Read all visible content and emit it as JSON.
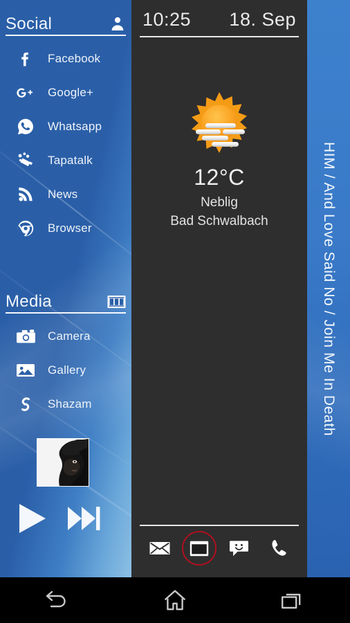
{
  "sidebar": {
    "sections": [
      {
        "title": "Social",
        "icon": "person-icon",
        "items": [
          {
            "label": "Facebook",
            "icon": "facebook-icon"
          },
          {
            "label": "Google+",
            "icon": "googleplus-icon"
          },
          {
            "label": "Whatsapp",
            "icon": "whatsapp-icon"
          },
          {
            "label": "Tapatalk",
            "icon": "tapatalk-icon"
          },
          {
            "label": "News",
            "icon": "rss-icon"
          },
          {
            "label": "Browser",
            "icon": "chrome-icon"
          }
        ]
      },
      {
        "title": "Media",
        "icon": "filmstrip-icon",
        "items": [
          {
            "label": "Camera",
            "icon": "camera-icon"
          },
          {
            "label": "Gallery",
            "icon": "gallery-icon"
          },
          {
            "label": "Shazam",
            "icon": "shazam-icon"
          }
        ]
      }
    ],
    "player": {
      "album_art": "album-art-thumbnail",
      "play_label": "play-icon",
      "next_label": "next-track-icon"
    },
    "colors": {
      "background_top": "#2a5fa8",
      "background_bottom": "#8dc0e4",
      "text": "#eef3f9"
    }
  },
  "center": {
    "status": {
      "time": "10:25",
      "date": "18. Sep"
    },
    "weather": {
      "icon": "sun-fog-icon",
      "temperature": "12°C",
      "condition": "Neblig",
      "location": "Bad Schwalbach"
    },
    "dock": [
      {
        "name": "email-icon",
        "label": "Email",
        "highlighted": false
      },
      {
        "name": "gmail-icon",
        "label": "Gmail",
        "highlighted": true
      },
      {
        "name": "messages-icon",
        "label": "Messages",
        "highlighted": false
      },
      {
        "name": "phone-icon",
        "label": "Phone",
        "highlighted": false
      }
    ],
    "colors": {
      "background": "#2e2e2e",
      "divider": "#e8e8e8",
      "highlight_ring": "#b01020"
    }
  },
  "right_panel": {
    "now_playing": "HIM / And Love Said No / Join Me In Death",
    "colors": {
      "background_top": "#3d81cd",
      "background_bottom": "#2a62b0"
    }
  },
  "navbar": {
    "buttons": [
      {
        "name": "back-icon",
        "label": "Back"
      },
      {
        "name": "home-icon",
        "label": "Home"
      },
      {
        "name": "recents-icon",
        "label": "Recent apps"
      }
    ],
    "colors": {
      "background": "#000000",
      "icon": "#c8c8c8"
    }
  }
}
